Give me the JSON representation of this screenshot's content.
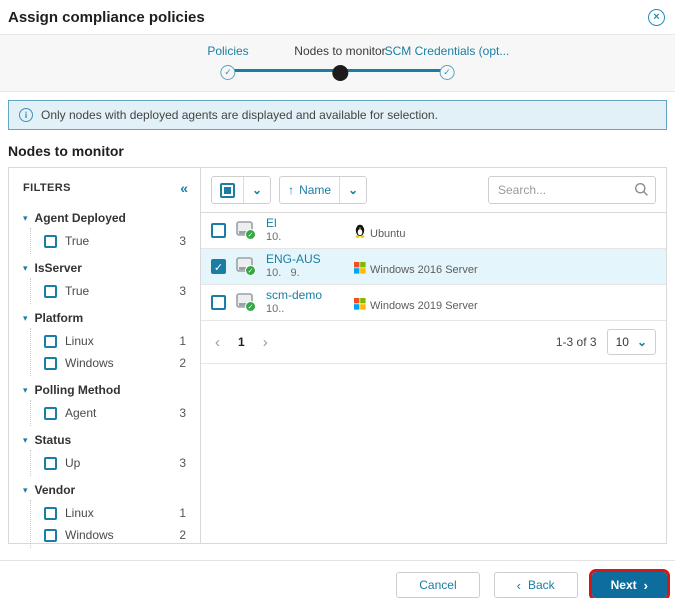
{
  "dialog": {
    "title": "Assign compliance policies"
  },
  "icons": {
    "close": "×",
    "check": "✓",
    "info": "i",
    "collapse": "«",
    "triangle": "▾",
    "sort_asc": "↑",
    "chevron_down": "⌄",
    "prev": "‹",
    "next": "›"
  },
  "stepper": {
    "steps": [
      {
        "label": "Policies",
        "state": "done"
      },
      {
        "label": "Nodes to monitor",
        "state": "current"
      },
      {
        "label": "SCM Credentials (opt...",
        "state": "upcoming"
      }
    ]
  },
  "banner": {
    "text": "Only nodes with deployed agents are displayed and available for selection."
  },
  "section_title": "Nodes to monitor",
  "filters": {
    "title": "FILTERS",
    "groups": [
      {
        "label": "Agent Deployed",
        "items": [
          {
            "label": "True",
            "count": 3,
            "checked": false
          }
        ]
      },
      {
        "label": "IsServer",
        "items": [
          {
            "label": "True",
            "count": 3,
            "checked": false
          }
        ]
      },
      {
        "label": "Platform",
        "items": [
          {
            "label": "Linux",
            "count": 1,
            "checked": false
          },
          {
            "label": "Windows",
            "count": 2,
            "checked": false
          }
        ]
      },
      {
        "label": "Polling Method",
        "items": [
          {
            "label": "Agent",
            "count": 3,
            "checked": false
          }
        ]
      },
      {
        "label": "Status",
        "items": [
          {
            "label": "Up",
            "count": 3,
            "checked": false
          }
        ]
      },
      {
        "label": "Vendor",
        "items": [
          {
            "label": "Linux",
            "count": 1,
            "checked": false
          },
          {
            "label": "Windows",
            "count": 2,
            "checked": false
          }
        ]
      }
    ]
  },
  "table": {
    "toolbar": {
      "sort_label": "Name"
    },
    "search": {
      "placeholder": "Search..."
    },
    "rows": [
      {
        "name": "El",
        "ip": "10.",
        "os": "Ubuntu",
        "os_icon": "ubuntu-logo",
        "checked": false,
        "highlighted": false
      },
      {
        "name": "ENG-AUS",
        "ip": "10.   9.",
        "os": "Windows 2016 Server",
        "os_icon": "windows-logo",
        "checked": true,
        "highlighted": true
      },
      {
        "name": "scm-demo",
        "ip": "10..",
        "os": "Windows 2019 Server",
        "os_icon": "windows-logo",
        "checked": false,
        "highlighted": false
      }
    ],
    "pagination": {
      "page": "1",
      "range": "1-3 of 3",
      "page_size": "10"
    }
  },
  "footer": {
    "cancel": "Cancel",
    "back": "Back",
    "next": "Next"
  },
  "colors": {
    "accent": "#1a7ea4",
    "banner_bg": "#e2f1f8",
    "banner_border": "#62a6c4",
    "row_highlight": "#e4f6fb",
    "next_button_bg": "#0d6e9d",
    "next_button_outline": "#d51717",
    "status_badge_green": "#35a745",
    "windows_logo": [
      "#f25022",
      "#7fba00",
      "#00a4ef",
      "#ffb900"
    ]
  }
}
